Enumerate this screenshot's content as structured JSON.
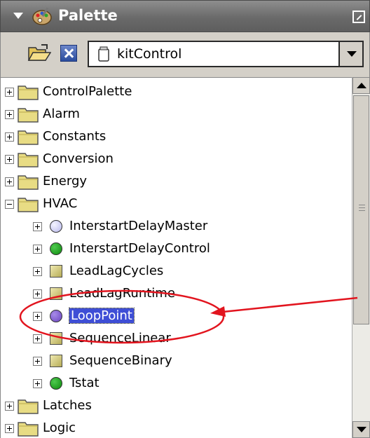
{
  "title": "Palette",
  "toolbar": {
    "open_icon": "open-folder-icon",
    "close_icon": "close-icon",
    "palette_value": "kitControl"
  },
  "tree": [
    {
      "label": "ControlPalette",
      "icon": "folder-icon",
      "expander": "plus"
    },
    {
      "label": "Alarm",
      "icon": "folder-icon",
      "expander": "plus"
    },
    {
      "label": "Constants",
      "icon": "folder-icon",
      "expander": "plus"
    },
    {
      "label": "Conversion",
      "icon": "folder-icon",
      "expander": "plus"
    },
    {
      "label": "Energy",
      "icon": "folder-icon",
      "expander": "plus"
    },
    {
      "label": "HVAC",
      "icon": "folder-icon",
      "expander": "minus"
    },
    {
      "label": "InterstartDelayMaster",
      "icon": "lavender-circle-icon",
      "expander": "plus"
    },
    {
      "label": "InterstartDelayControl",
      "icon": "green-circle-icon",
      "expander": "plus"
    },
    {
      "label": "LeadLagCycles",
      "icon": "square-block-icon",
      "expander": "plus"
    },
    {
      "label": "LeadLagRuntime",
      "icon": "square-block-icon",
      "expander": "plus"
    },
    {
      "label": "LoopPoint",
      "icon": "purple-circle-icon",
      "expander": "plus",
      "selected": true
    },
    {
      "label": "SequenceLinear",
      "icon": "square-block-icon",
      "expander": "plus"
    },
    {
      "label": "SequenceBinary",
      "icon": "square-block-icon",
      "expander": "plus"
    },
    {
      "label": "Tstat",
      "icon": "green-circle-icon",
      "expander": "plus"
    },
    {
      "label": "Latches",
      "icon": "folder-icon",
      "expander": "plus"
    },
    {
      "label": "Logic",
      "icon": "folder-icon",
      "expander": "plus"
    }
  ],
  "colors": {
    "selection": "#3e4ed6",
    "annotation": "#e2141e",
    "folder": "#e8dc84"
  }
}
